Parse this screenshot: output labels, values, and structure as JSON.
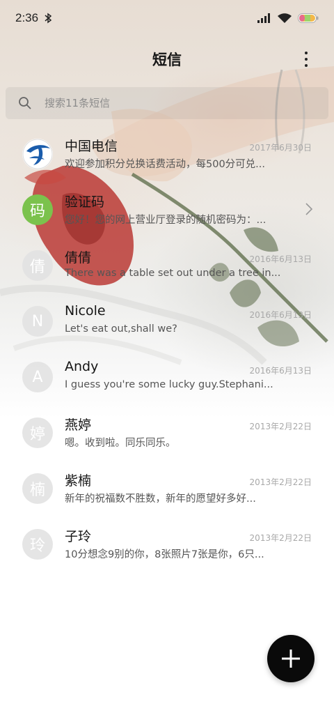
{
  "status_bar": {
    "time": "2:36",
    "icons": [
      "bluetooth-icon",
      "signal-icon",
      "wifi-icon",
      "battery-icon"
    ]
  },
  "header": {
    "title": "短信",
    "menu_icon": "more-vertical-icon"
  },
  "search": {
    "placeholder": "搜索11条短信",
    "icon": "search-icon"
  },
  "conversations": [
    {
      "avatar": "",
      "avatar_type": "telecom-logo",
      "name": "中国电信",
      "preview": "欢迎参加积分兑换话费活动，每500分可兑...",
      "date": "2017年6月30日"
    },
    {
      "avatar": "码",
      "avatar_type": "green",
      "name": "验证码",
      "preview": "您好！您的网上营业厅登录的随机密码为：...",
      "date": "",
      "chevron": "chevron-right-icon"
    },
    {
      "avatar": "倩",
      "avatar_type": "grey",
      "name": "倩倩",
      "preview": "There was a table set out under a tree in...",
      "date": "2016年6月13日"
    },
    {
      "avatar": "N",
      "avatar_type": "grey",
      "name": "Nicole",
      "preview": "Let's eat out,shall we?",
      "date": "2016年6月13日"
    },
    {
      "avatar": "A",
      "avatar_type": "grey",
      "name": "Andy",
      "preview": "I guess you're some lucky guy.Stephani...",
      "date": "2016年6月13日"
    },
    {
      "avatar": "婷",
      "avatar_type": "grey",
      "name": "燕婷",
      "preview": "嗯。收到啦。同乐同乐。",
      "date": "2013年2月22日"
    },
    {
      "avatar": "楠",
      "avatar_type": "grey",
      "name": "紫楠",
      "preview": "新年的祝福数不胜数，新年的愿望好多好...",
      "date": "2013年2月22日"
    },
    {
      "avatar": "玲",
      "avatar_type": "grey",
      "name": "子玲",
      "preview": "10分想念9别的你，8张照片7张是你，6只...",
      "date": "2013年2月22日"
    }
  ],
  "fab": {
    "icon": "plus-icon"
  },
  "colors": {
    "fab": "#0a0a0a",
    "verify_avatar": "#7bc24d",
    "rose": "#b8332e"
  }
}
